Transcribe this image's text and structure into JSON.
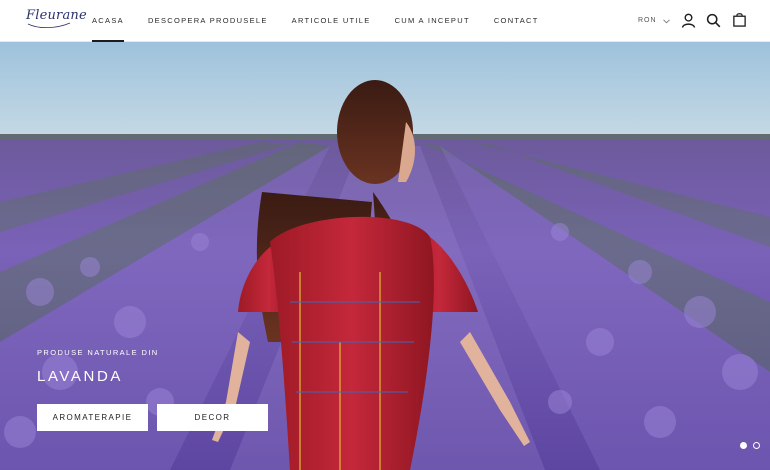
{
  "header": {
    "logo_text": "Fleurane",
    "nav": [
      {
        "label": "ACASA",
        "active": true
      },
      {
        "label": "DESCOPERA PRODUSELE",
        "active": false
      },
      {
        "label": "ARTICOLE UTILE",
        "active": false
      },
      {
        "label": "CUM A INCEPUT",
        "active": false
      },
      {
        "label": "CONTACT",
        "active": false
      }
    ],
    "currency": "RON",
    "icons": [
      "account-icon",
      "search-icon",
      "cart-bag-icon"
    ]
  },
  "hero": {
    "subtitle": "PRODUSE NATURALE DIN",
    "title": "LAVANDA",
    "buttons": [
      {
        "label": "AROMATERAPIE"
      },
      {
        "label": "DECOR"
      }
    ],
    "slides_total": 2,
    "active_slide": 1
  },
  "colors": {
    "nav_text": "#2a2a2a",
    "logo": "#2b2f6b",
    "sky": "#a8c8dd",
    "lavender": "#7a62b8",
    "dress_red": "#b3202c",
    "hair": "#4a2418",
    "button_bg": "#ffffff",
    "overlay_text": "#ffffff"
  }
}
